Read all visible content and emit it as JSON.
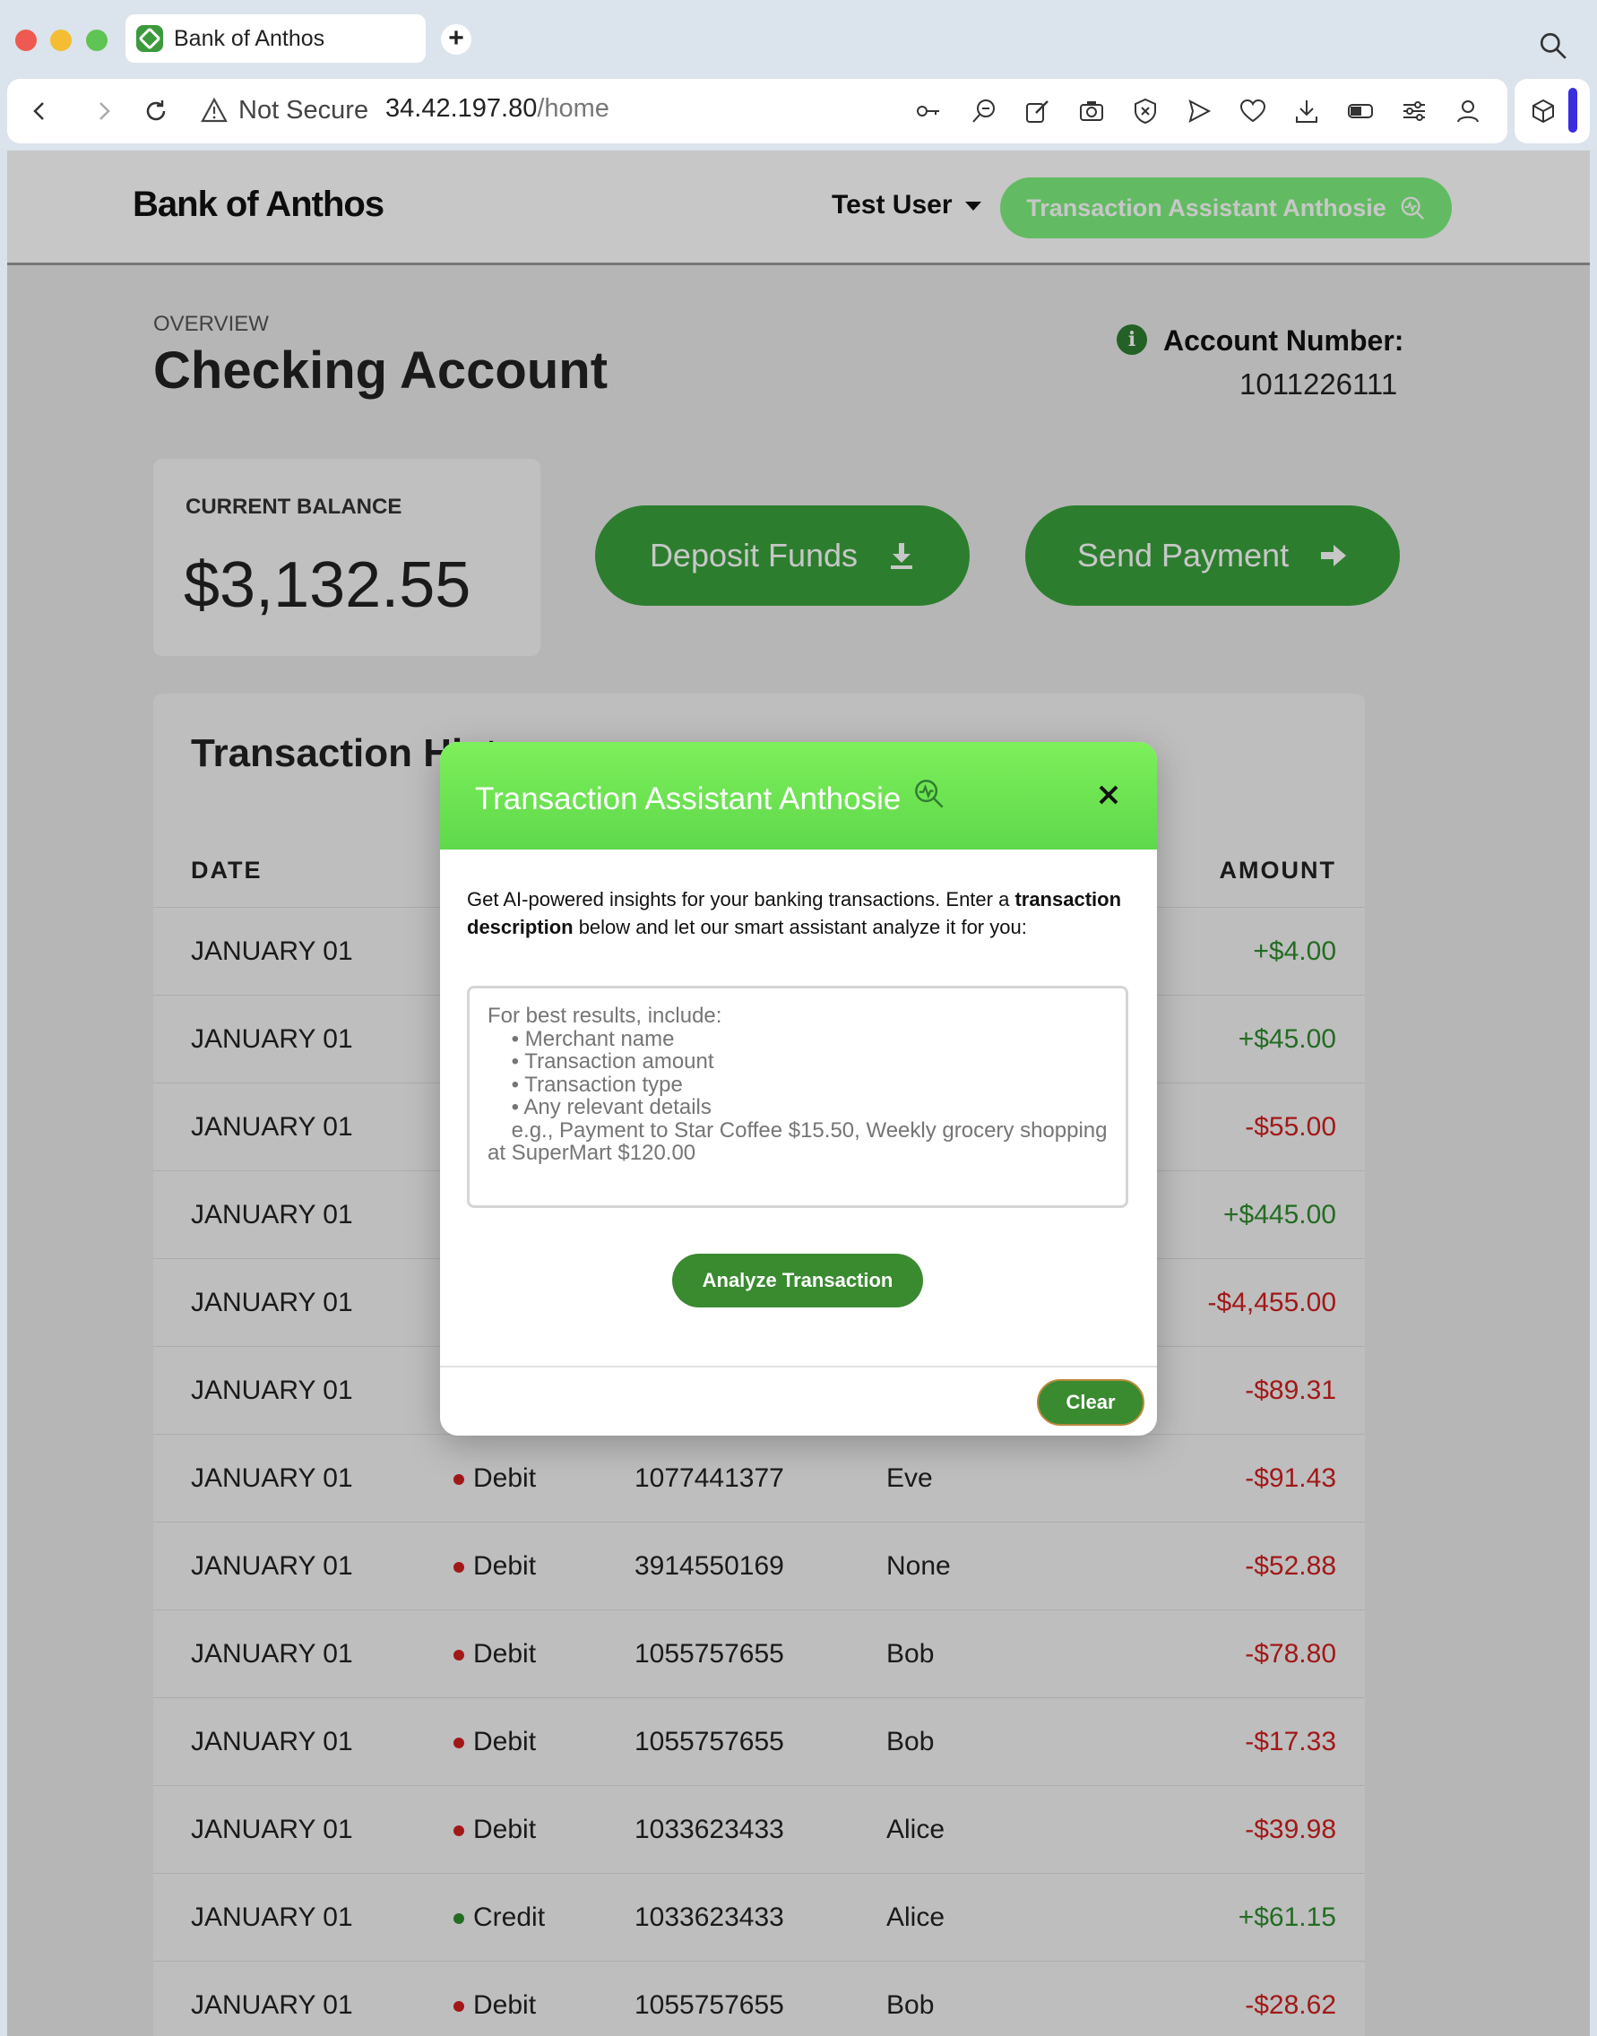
{
  "browser": {
    "tab_title": "Bank of Anthos",
    "security_label": "Not Secure",
    "url_host": "34.42.197.80",
    "url_path": "/home"
  },
  "header": {
    "brand": "Bank of Anthos",
    "user": "Test User",
    "assistant_button": "Transaction Assistant Anthosie"
  },
  "account": {
    "overview_label": "OVERVIEW",
    "title": "Checking Account",
    "number_label": "Account Number:",
    "number": "1011226111",
    "balance_label": "CURRENT BALANCE",
    "balance": "$3,132.55"
  },
  "actions": {
    "deposit": "Deposit Funds",
    "send": "Send Payment"
  },
  "transactions": {
    "title": "Transaction Hist",
    "columns": {
      "date": "DATE",
      "amount": "AMOUNT"
    },
    "rows": [
      {
        "date": "JANUARY 01",
        "type": "",
        "account": "",
        "name": "",
        "amount": "+$4.00"
      },
      {
        "date": "JANUARY 01",
        "type": "",
        "account": "",
        "name": "",
        "amount": "+$45.00"
      },
      {
        "date": "JANUARY 01",
        "type": "",
        "account": "",
        "name": "",
        "amount": "-$55.00"
      },
      {
        "date": "JANUARY 01",
        "type": "",
        "account": "",
        "name": "",
        "amount": "+$445.00"
      },
      {
        "date": "JANUARY 01",
        "type": "",
        "account": "",
        "name": "",
        "amount": "-$4,455.00"
      },
      {
        "date": "JANUARY 01",
        "type": "",
        "account": "",
        "name": "",
        "amount": "-$89.31"
      },
      {
        "date": "JANUARY 01",
        "type": "Debit",
        "account": "1077441377",
        "name": "Eve",
        "amount": "-$91.43"
      },
      {
        "date": "JANUARY 01",
        "type": "Debit",
        "account": "3914550169",
        "name": "None",
        "amount": "-$52.88"
      },
      {
        "date": "JANUARY 01",
        "type": "Debit",
        "account": "1055757655",
        "name": "Bob",
        "amount": "-$78.80"
      },
      {
        "date": "JANUARY 01",
        "type": "Debit",
        "account": "1055757655",
        "name": "Bob",
        "amount": "-$17.33"
      },
      {
        "date": "JANUARY 01",
        "type": "Debit",
        "account": "1033623433",
        "name": "Alice",
        "amount": "-$39.98"
      },
      {
        "date": "JANUARY 01",
        "type": "Credit",
        "account": "1033623433",
        "name": "Alice",
        "amount": "+$61.15"
      },
      {
        "date": "JANUARY 01",
        "type": "Debit",
        "account": "1055757655",
        "name": "Bob",
        "amount": "-$28.62"
      }
    ]
  },
  "modal": {
    "title": "Transaction Assistant Anthosie",
    "intro_1": "Get AI-powered insights for your banking transactions. Enter a ",
    "intro_bold": "transaction description",
    "intro_2": " below and let our smart assistant analyze it for you:",
    "placeholder": "For best results, include:\n    • Merchant name\n    • Transaction amount\n    • Transaction type\n    • Any relevant details\n    e.g., Payment to Star Coffee $15.50, Weekly grocery shopping at SuperMart $120.00",
    "analyze_button": "Analyze Transaction",
    "clear_button": "Clear"
  },
  "colors": {
    "primary_green": "#39a23c",
    "modal_header": "#7df05a",
    "positive": "#2e8b2e",
    "negative": "#d01f1f"
  }
}
